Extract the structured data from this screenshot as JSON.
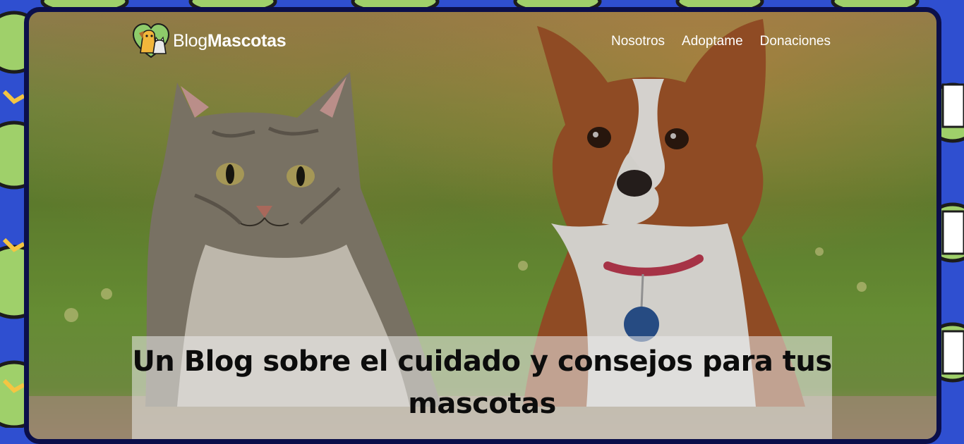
{
  "brand": {
    "prefix": "Blog",
    "name": "Mascotas",
    "logo_icon": "cat-and-dog-heart-icon"
  },
  "nav": {
    "items": [
      {
        "label": "Nosotros"
      },
      {
        "label": "Adoptame"
      },
      {
        "label": "Donaciones"
      }
    ]
  },
  "hero": {
    "title": "Un Blog sobre el cuidado y consejos para tus mascotas",
    "image": "cat-and-dog-photo"
  },
  "colors": {
    "frame": "#0b0f4a",
    "pattern_blue": "#2f4fd0",
    "pattern_green": "#9fd06a",
    "pattern_yellow": "#f5c542",
    "nav_text": "#ffffff",
    "title_text": "#0c0c0c"
  }
}
